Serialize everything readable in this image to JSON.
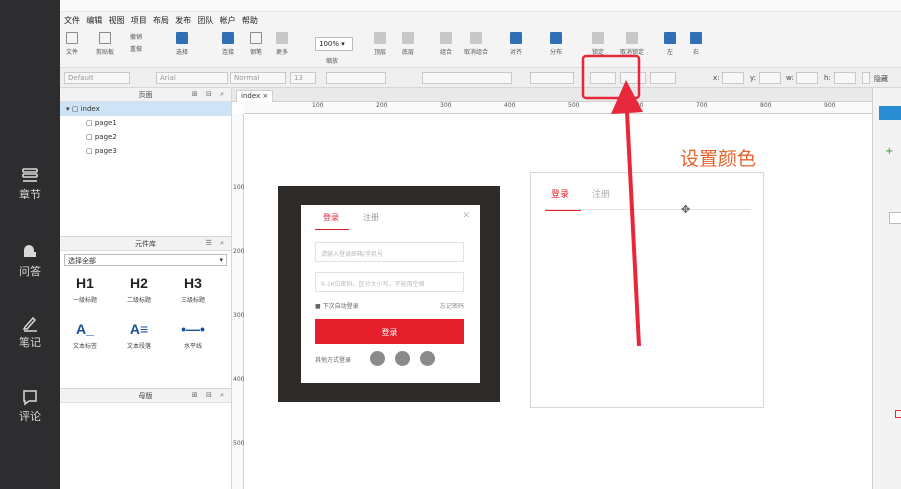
{
  "course_sidebar": {
    "items": [
      {
        "label": "章节",
        "icon": "layers-icon"
      },
      {
        "label": "问答",
        "icon": "chat-icon"
      },
      {
        "label": "笔记",
        "icon": "pencil-icon"
      },
      {
        "label": "评论",
        "icon": "comment-icon"
      }
    ]
  },
  "menubar": {
    "items": [
      "文件",
      "编辑",
      "视图",
      "项目",
      "布局",
      "发布",
      "团队",
      "帐户",
      "帮助"
    ]
  },
  "toolbar": {
    "file_label": "文件",
    "clipboard_label": "剪贴板",
    "undo_label": "撤销",
    "redo_label": "重做",
    "select_label": "选择",
    "connect_label": "连接",
    "pen_label": "钢笔",
    "more_label": "更多",
    "zoom_value": "100%",
    "zoom_label": "缩放",
    "top_label": "顶层",
    "bottom_label": "底层",
    "group_label": "组合",
    "ungroup_label": "取消组合",
    "align_label": "对齐",
    "distribute_label": "分布",
    "lock_label": "锁定",
    "unlock_label": "取消锁定",
    "left_label": "左",
    "right_label": "右"
  },
  "formatbar": {
    "style_value": "Default",
    "font_value": "Arial",
    "weight_value": "Normal",
    "size_value": "13",
    "x_label": "x:",
    "y_label": "y:",
    "w_label": "w:",
    "h_label": "h:",
    "hide_label": "隐藏"
  },
  "pages_panel": {
    "title": "页面",
    "pages": [
      "index",
      "page1",
      "page2",
      "page3"
    ]
  },
  "library_panel": {
    "title": "元件库",
    "select_value": "选择全部",
    "widgets": [
      {
        "glyph": "H1",
        "label": "一级标题"
      },
      {
        "glyph": "H2",
        "label": "二级标题"
      },
      {
        "glyph": "H3",
        "label": "三级标题"
      },
      {
        "glyph": "A_",
        "label": "文本标签"
      },
      {
        "glyph": "A≡",
        "label": "文本段落"
      },
      {
        "glyph": "•—•",
        "label": "水平线"
      }
    ]
  },
  "master_panel": {
    "title": "母版"
  },
  "canvas": {
    "tab": "index",
    "ruler_top": [
      "100",
      "200",
      "300",
      "400",
      "500",
      "600",
      "700",
      "800",
      "900"
    ],
    "ruler_left": [
      "100",
      "200",
      "300",
      "400",
      "500"
    ]
  },
  "mock_login": {
    "tab_login": "登录",
    "tab_register": "注册",
    "phone_placeholder": "请输入登录邮箱/手机号",
    "password_placeholder": "6-16位密码，区分大小写，不能用空格",
    "remember_label": "下次自动登录",
    "forgot_label": "忘记密码",
    "login_button": "登录",
    "other_label": "其他方式登录"
  },
  "login_frame": {
    "tab_login": "登录",
    "tab_register": "注册"
  },
  "annotation": {
    "text": "设置颜色"
  },
  "colors": {
    "accent_red": "#e5202c",
    "annotation_orange": "#e8632c",
    "highlight_box": "#e8283a",
    "sidebar_dark": "#2d2d2f"
  }
}
